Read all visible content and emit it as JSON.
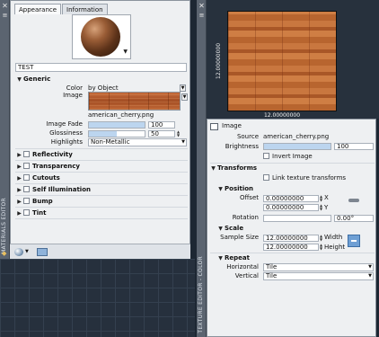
{
  "material_editor": {
    "title": "MATERIALS EDITOR",
    "tabs": [
      "Appearance",
      "Information"
    ],
    "material_name": "TEST",
    "generic": {
      "header": "Generic",
      "color_label": "Color",
      "color_value": "by Object",
      "image_label": "Image",
      "image_file": "american_cherry.png",
      "image_fade_label": "Image Fade",
      "image_fade_value": "100",
      "image_fade_level": 1.0,
      "glossiness_label": "Glossiness",
      "glossiness_value": "50",
      "glossiness_level": 0.5,
      "highlights_label": "Highlights",
      "highlights_value": "Non-Metallic"
    },
    "sections": [
      "Reflectivity",
      "Transparency",
      "Cutouts",
      "Self Illumination",
      "Bump",
      "Tint"
    ]
  },
  "texture_editor": {
    "title": "TEXTURE EDITOR - COLOR",
    "dim_width": "12.00000000",
    "dim_height": "12.00000000",
    "image": {
      "header": "Image",
      "source_label": "Source",
      "source_value": "american_cherry.png",
      "brightness_label": "Brightness",
      "brightness_value": "100",
      "brightness_level": 1.0,
      "invert_label": "Invert Image"
    },
    "transforms": {
      "header": "Transforms",
      "link_label": "Link texture transforms"
    },
    "position": {
      "header": "Position",
      "offset_label": "Offset",
      "offset_x": "0.00000000",
      "offset_y": "0.00000000",
      "x_label": "X",
      "y_label": "Y",
      "rotation_label": "Rotation",
      "rotation_value": "0.00°"
    },
    "scale": {
      "header": "Scale",
      "sample_size_label": "Sample Size",
      "width_value": "12.00000000",
      "height_value": "12.00000000",
      "width_label": "Width",
      "height_label": "Height"
    },
    "repeat": {
      "header": "Repeat",
      "horizontal_label": "Horizontal",
      "horizontal_value": "Tile",
      "vertical_label": "Vertical",
      "vertical_value": "Tile"
    }
  }
}
